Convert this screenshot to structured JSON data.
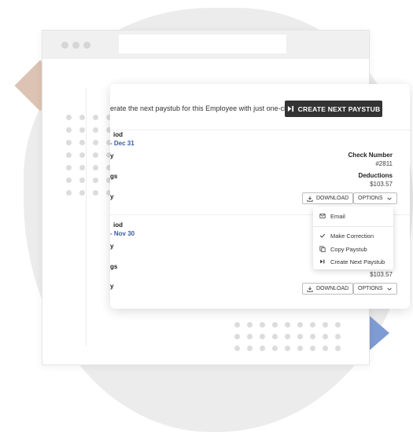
{
  "banner": {
    "text": "erate the next paystub for this Employee with just one-click.",
    "cta_label": "CREATE NEXT PAYSTUB",
    "cta_icon": "skip-next-icon"
  },
  "stubs": [
    {
      "period_label": "iod",
      "period_dates": "- Dec 31",
      "row_a": "y",
      "row_b": "gs",
      "row_c": "y",
      "check_label": "Check Number",
      "check_value": "#2811",
      "deductions_label": "Deductions",
      "deductions_value": "$103.57",
      "download_label": "DOWNLOAD",
      "options_label": "OPTIONS"
    },
    {
      "period_label": "iod",
      "period_dates": "- Nov 30",
      "row_a": "y",
      "row_b": "gs",
      "row_c": "y",
      "deductions_value": "$103.57",
      "download_label": "DOWNLOAD",
      "options_label": "OPTIONS"
    }
  ],
  "options_menu": {
    "items": [
      {
        "label": "Email",
        "icon": "email-icon"
      },
      {
        "label": "Make Correction",
        "icon": "check-icon"
      },
      {
        "label": "Copy Paystub",
        "icon": "copy-icon"
      },
      {
        "label": "Create Next Paystub",
        "icon": "skip-next-icon"
      }
    ]
  },
  "colors": {
    "accent_blue": "#3b5aa6",
    "cta_background": "#333333",
    "triangle": "#7f9bd4",
    "diamond": "#dcc3b4"
  }
}
